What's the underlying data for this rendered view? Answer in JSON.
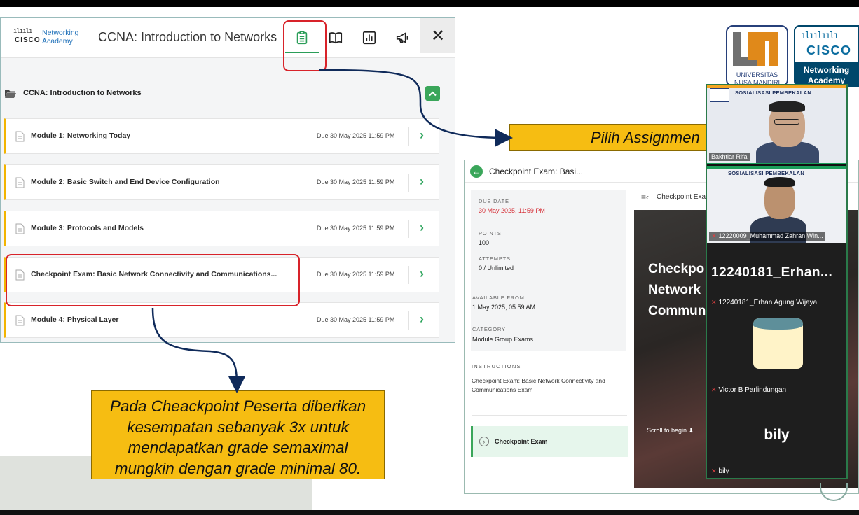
{
  "left_panel": {
    "logo_line1": "Networking",
    "logo_line2": "Academy",
    "logo_word": "CISCO",
    "course_title": "CCNA: Introduction to Networks",
    "course_row_label": "CCNA: Introduction to Networks",
    "close_glyph": "✕",
    "modules": [
      {
        "title": "Module 1: Networking Today",
        "due": "Due 30 May 2025 11:59 PM"
      },
      {
        "title": "Module 2: Basic Switch and End Device Configuration",
        "due": "Due 30 May 2025 11:59 PM"
      },
      {
        "title": "Module 3: Protocols and Models",
        "due": "Due 30 May 2025 11:59 PM"
      },
      {
        "title": "Checkpoint Exam: Basic Network Connectivity and Communications...",
        "due": "Due 30 May 2025 11:59 PM"
      },
      {
        "title": "Module 4: Physical Layer",
        "due": "Due 30 May 2025 11:59 PM"
      }
    ]
  },
  "callouts": {
    "assign": "Pilih Assignmen",
    "checkpoint_lines": [
      "Pada Cheackpoint Peserta diberikan",
      "kesempatan sebanyak 3x untuk",
      "mendapatkan grade semaximal",
      "mungkin dengan grade minimal 80."
    ]
  },
  "right_panel": {
    "title": "Checkpoint Exam: Basi...",
    "due_label": "DUE DATE",
    "due_value": "30 May 2025, 11:59 PM",
    "points_label": "POINTS",
    "points_value": "100",
    "attempts_label": "ATTEMPTS",
    "attempts_value": "0 / Unlimited",
    "available_label": "AVAILABLE FROM",
    "available_value": "1 May 2025, 05:59 AM",
    "category_label": "CATEGORY",
    "category_value": "Module Group Exams",
    "instructions_label": "INSTRUCTIONS",
    "instructions_text": "Checkpoint Exam: Basic Network Connectivity and Communications Exam",
    "item_label": "Checkpoint Exam",
    "viewer_title": "Checkpoint Exa",
    "hero_lines": [
      "Checkpo",
      "Network",
      "Commun"
    ],
    "scroll_hint": "Scroll to begin"
  },
  "logos": {
    "unm_text1": "UNIVERSITAS",
    "unm_text2": "NUSA MANDIRI",
    "cisco_word": "CISCO",
    "cisco_na1": "Networking",
    "cisco_na2": "Academy"
  },
  "video": {
    "tile1_banner": "SOSIALISASI PEMBEKALAN",
    "tile1_name": "Bakhtiar Rifa",
    "tile2_banner": "SOSIALISASI PEMBEKALAN",
    "tile2_name": "12220009_Muhammad Zahran Win...",
    "tile3_big": "12240181_Erhan...",
    "tile3_sub": "12240181_Erhan Agung Wijaya",
    "tile4_sub": "Victor B Parlindungan",
    "tile5_big": "bily",
    "tile5_sub": "bily"
  },
  "colors": {
    "accent_green": "#3aa65a",
    "highlight_red": "#d8232a",
    "callout_yellow": "#f6bd12",
    "arrow_navy": "#0f2a5a"
  }
}
